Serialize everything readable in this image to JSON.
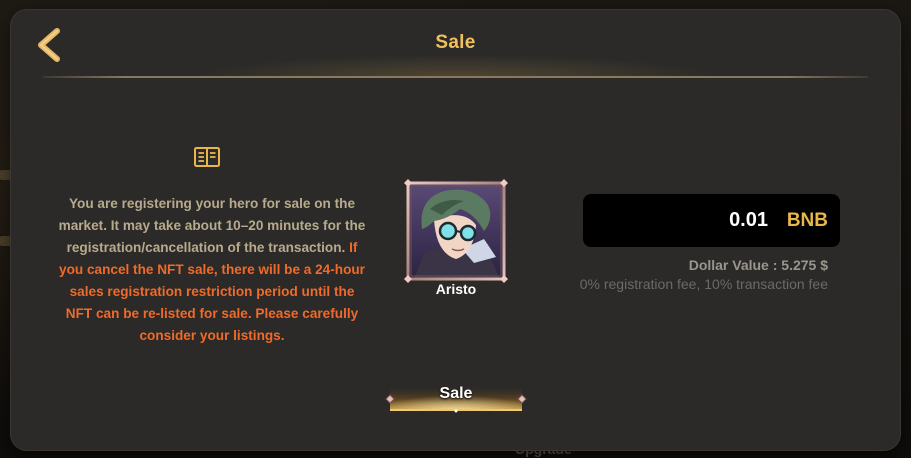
{
  "dialog": {
    "title": "Sale",
    "notice": {
      "normal": "You are registering your hero for sale on the market. It may take about 10–20 minutes for the registration/cancellation of the transaction.",
      "warning": "If you cancel the NFT sale, there will be a 24-hour sales registration restriction period until the NFT can be re-listed for sale. Please carefully consider your listings."
    },
    "hero": {
      "name": "Aristo"
    },
    "price": {
      "value": "0.01",
      "currency": "BNB",
      "dollar_value": "Dollar Value : 5.275 $",
      "fee_note": "0% registration fee, 10% transaction fee"
    },
    "sale_button_label": "Sale"
  },
  "background": {
    "underlying_label": "Upgrade"
  },
  "colors": {
    "title": "#f0c060",
    "warning": "#f06a2a",
    "body_text": "#b8aa8c",
    "currency": "#e8b64a",
    "panel": "#2b2a28"
  },
  "icons": [
    "back-arrow-icon",
    "book-icon",
    "diamond-icon"
  ]
}
